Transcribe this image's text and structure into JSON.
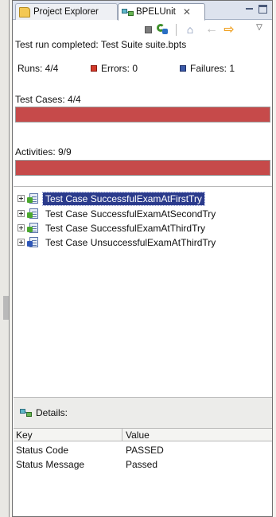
{
  "tabs": [
    {
      "label": "Project Explorer",
      "icon": "folder-icon",
      "active": false
    },
    {
      "label": "BPELUnit",
      "icon": "bpelunit-icon",
      "active": true
    }
  ],
  "toolbar": {
    "stop_icon": "stop-icon",
    "rerun_icon": "rerun-icon",
    "home_icon": "home-icon",
    "back_icon": "back-arrow-icon",
    "forward_icon": "forward-arrow-icon",
    "menu_icon": "view-menu-icon"
  },
  "summary": "Test run completed: Test Suite suite.bpts",
  "counts": {
    "runs": "Runs:  4/4",
    "errors": "Errors:  0",
    "failures": "Failures:  1"
  },
  "progress": {
    "test_cases_label": "Test Cases: 4/4",
    "test_cases_fraction": 1.0,
    "activities_label": "Activities: 9/9",
    "activities_fraction": 1.0,
    "bar_color": "#c64a4a"
  },
  "tree": [
    {
      "label": "Test Case SuccessfulExamAtFirstTry",
      "status": "passed",
      "selected": true
    },
    {
      "label": "Test Case SuccessfulExamAtSecondTry",
      "status": "passed",
      "selected": false
    },
    {
      "label": "Test Case SuccessfulExamAtThirdTry",
      "status": "passed",
      "selected": false
    },
    {
      "label": "Test Case UnsuccessfulExamAtThirdTry",
      "status": "failed",
      "selected": false
    }
  ],
  "details": {
    "title": "Details:",
    "columns": [
      "Key",
      "Value"
    ],
    "rows": [
      [
        "Status Code",
        "PASSED"
      ],
      [
        "Status Message",
        "Passed"
      ]
    ]
  }
}
